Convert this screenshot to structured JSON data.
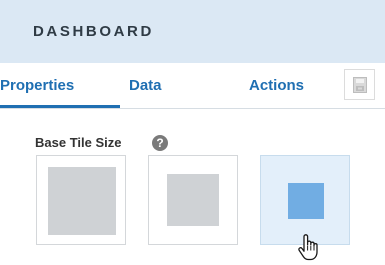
{
  "header": {
    "title": "DASHBOARD"
  },
  "tabs": [
    {
      "label": "Properties",
      "active": true
    },
    {
      "label": "Data",
      "active": false
    },
    {
      "label": "Actions",
      "active": false
    }
  ],
  "tab_icon": "save-icon",
  "base_tile_size": {
    "label": "Base Tile Size",
    "help_glyph": "?",
    "options": [
      {
        "name": "large",
        "selected": false,
        "color": "#cfd2d5"
      },
      {
        "name": "medium",
        "selected": false,
        "color": "#cfd2d5"
      },
      {
        "name": "small",
        "selected": true,
        "color": "#71ade3"
      }
    ]
  },
  "colors": {
    "header_bg": "#dbe8f4",
    "accent": "#1f6fb2",
    "selected_bg": "#e3effa"
  }
}
